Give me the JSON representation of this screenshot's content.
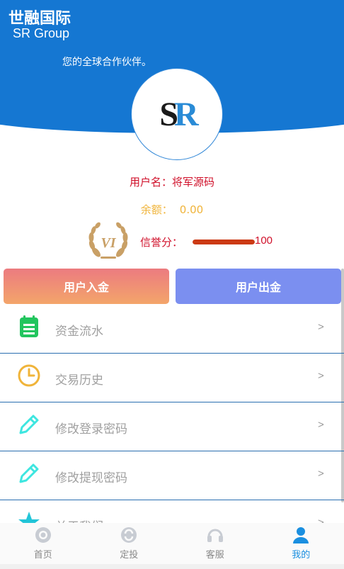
{
  "header": {
    "brand_cn": "世融国际",
    "brand_en": "SR Group",
    "slogan": "您的全球合作伙伴。",
    "bg_color": "#1577d2"
  },
  "logo": {
    "s": "S",
    "r": "R"
  },
  "profile": {
    "username_label": "用户名：",
    "username_value": "将军源码",
    "balance_label": "余额：",
    "balance_value": "0.00",
    "vip_level": "VI",
    "credit_label": "信誉分：",
    "credit_value": "100",
    "credit_fraction": 1.0
  },
  "actions": {
    "deposit_label": "用户入金",
    "withdraw_label": "用户出金"
  },
  "menu": [
    {
      "label": "资金流水",
      "icon": "clipboard-icon",
      "arrow": ">"
    },
    {
      "label": "交易历史",
      "icon": "clock-icon",
      "arrow": ">"
    },
    {
      "label": "修改登录密码",
      "icon": "pencil-icon",
      "arrow": ">"
    },
    {
      "label": "修改提现密码",
      "icon": "pencil-icon",
      "arrow": ">"
    },
    {
      "label": "关于我们",
      "icon": "star-icon",
      "arrow": ">"
    }
  ],
  "tabbar": [
    {
      "label": "首页",
      "icon": "home-icon"
    },
    {
      "label": "定投",
      "icon": "invest-icon"
    },
    {
      "label": "客服",
      "icon": "headset-icon"
    },
    {
      "label": "我的",
      "icon": "user-icon",
      "active": true
    }
  ],
  "colors": {
    "accent_red": "#d0102a",
    "balance_yellow": "#f0b43a",
    "deposit_gradient_start": "#ec7b80",
    "withdraw_blue": "#7b8ff0",
    "tab_active": "#1a8fe0"
  }
}
